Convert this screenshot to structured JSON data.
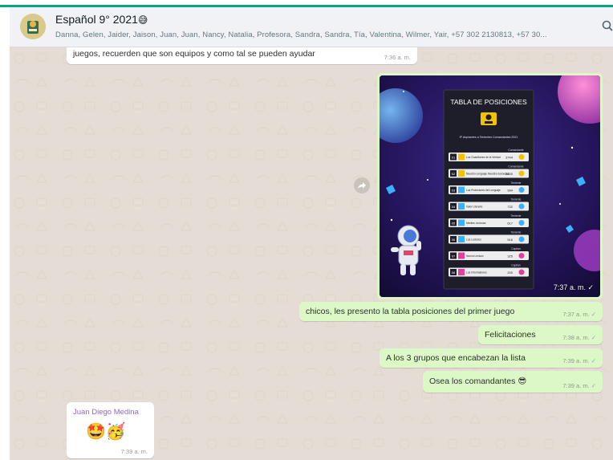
{
  "header": {
    "title": "Español 9° 2021",
    "title_emoji": "😅",
    "members": "Danna, Gelen, Jaider, Jaison, Juan, Juan, Nancy, Natalia, Profesora, Sandra, Sandra, Tía, Valentina, Wilmer, Yair, +57 302 2130813, +57 30..."
  },
  "messages": {
    "m1": {
      "text": "juegos, recuerden que son equipos y como tal se pueden ayudar",
      "time": "7:36 a. m."
    },
    "image": {
      "time": "7:37 a. m.",
      "board_title": "TABLA DE POSICIONES",
      "board_subtitle": "9º Aspirantes a Tenientes Comandantes 2021",
      "rows": [
        {
          "pos": "01",
          "name": "Los Guardianes de la Verdad",
          "pts": "3744",
          "rank": "Comandante"
        },
        {
          "pos": "02",
          "name": "Nuestro Lenguaje Nuestra Sociedad",
          "pts": "2800",
          "rank": "Comandante"
        },
        {
          "pos": "03",
          "name": "Los Protectores del Lenguaje",
          "pts": "994",
          "rank": "Teniente"
        },
        {
          "pos": "04",
          "name": "Valor Literario",
          "pts": "732",
          "rank": "Teniente"
        },
        {
          "pos": "05",
          "name": "Mentes Lectoras",
          "pts": "617",
          "rank": "Teniente"
        },
        {
          "pos": "06",
          "name": "Los Lectores",
          "pts": "516",
          "rank": "Teniente"
        },
        {
          "pos": "07",
          "name": "Nueva Lectura",
          "pts": "325",
          "rank": "Capitan"
        },
        {
          "pos": "08",
          "name": "Los Informadores",
          "pts": "200",
          "rank": "Capitan"
        }
      ]
    },
    "m2": {
      "text": "chicos, les presento la tabla posiciones del primer juego",
      "time": "7:37 a. m."
    },
    "m3": {
      "text": "Felicitaciones",
      "time": "7:38 a. m."
    },
    "m4": {
      "text": "A los 3 grupos que encabezan la lista",
      "time": "7:39 a. m."
    },
    "m5": {
      "text": "Osea los comandantes",
      "emoji": "😎",
      "time": "7:39 a. m."
    },
    "m6": {
      "sender": "Juan Diego Medina",
      "emoji": "🤩🥳",
      "time": "7:39 a. m."
    }
  },
  "colors": {
    "accent": "#00a884",
    "outgoing": "#dcf8c6",
    "incoming": "#ffffff",
    "chat_bg": "#e5ddd5"
  }
}
